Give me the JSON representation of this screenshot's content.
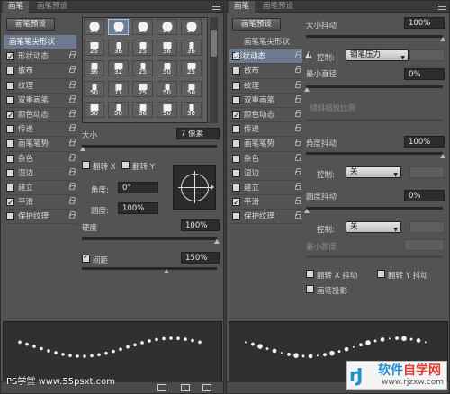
{
  "left": {
    "tabs": [
      "画笔",
      "画笔预设"
    ],
    "preset_button": "画笔预设",
    "sidebar": [
      {
        "label": "画笔笔尖形状",
        "checked": null,
        "active": true
      },
      {
        "label": "形状动态",
        "checked": true
      },
      {
        "label": "散布",
        "checked": false
      },
      {
        "label": "纹理",
        "checked": false
      },
      {
        "label": "双重画笔",
        "checked": false
      },
      {
        "label": "颜色动态",
        "checked": true
      },
      {
        "label": "传递",
        "checked": false
      },
      {
        "label": "画笔笔势",
        "checked": false
      },
      {
        "label": "杂色",
        "checked": false
      },
      {
        "label": "湿边",
        "checked": false
      },
      {
        "label": "建立",
        "checked": false
      },
      {
        "label": "平滑",
        "checked": true
      },
      {
        "label": "保护纹理",
        "checked": false
      }
    ],
    "tip_sizes": [
      "30",
      "30",
      "30",
      "25",
      "25",
      "25",
      "36",
      "25",
      "36",
      "36",
      "36",
      "32",
      "25",
      "50",
      "25",
      "50",
      "71",
      "25",
      "50",
      "50",
      "50",
      "50",
      "36",
      "30",
      "30"
    ],
    "size_label": "大小",
    "size_value": "7 像素",
    "flip_x": "翻转 X",
    "flip_y": "翻转 Y",
    "angle_label": "角度:",
    "angle_value": "0°",
    "roundness_label": "圆度:",
    "roundness_value": "100%",
    "hardness_label": "硬度",
    "hardness_value": "100%",
    "spacing_label": "间距",
    "spacing_value": "150%",
    "spacing_checked": true
  },
  "right": {
    "tabs": [
      "画笔",
      "画笔预设"
    ],
    "preset_button": "画笔预设",
    "sidebar": [
      {
        "label": "画笔笔尖形状",
        "checked": null,
        "active": false
      },
      {
        "label": "形状动态",
        "checked": true,
        "active": true
      },
      {
        "label": "散布",
        "checked": false
      },
      {
        "label": "纹理",
        "checked": false
      },
      {
        "label": "双重画笔",
        "checked": false
      },
      {
        "label": "颜色动态",
        "checked": true
      },
      {
        "label": "传递",
        "checked": false
      },
      {
        "label": "画笔笔势",
        "checked": false
      },
      {
        "label": "杂色",
        "checked": false
      },
      {
        "label": "湿边",
        "checked": false
      },
      {
        "label": "建立",
        "checked": false
      },
      {
        "label": "平滑",
        "checked": true
      },
      {
        "label": "保护纹理",
        "checked": false
      }
    ],
    "size_jitter_label": "大小抖动",
    "size_jitter_value": "100%",
    "control_label": "控制:",
    "control_value": "钢笔压力",
    "min_diameter_label": "最小直径",
    "min_diameter_value": "0%",
    "tilt_scale_label": "倾斜缩放比例",
    "angle_jitter_label": "角度抖动",
    "angle_jitter_value": "100%",
    "angle_control_value": "关",
    "roundness_jitter_label": "圆度抖动",
    "roundness_jitter_value": "0%",
    "roundness_control_value": "关",
    "min_roundness_label": "最小圆度",
    "flip_x_jitter": "翻转 X 抖动",
    "flip_y_jitter": "翻转 Y 抖动",
    "brush_projection": "画笔投影"
  },
  "watermark_left": "PS学堂 www.55psxt.com",
  "watermark_logo": {
    "mark": "rJ",
    "title": "软件",
    "title_red": "自学网",
    "url": "www.rjzxw.com"
  }
}
